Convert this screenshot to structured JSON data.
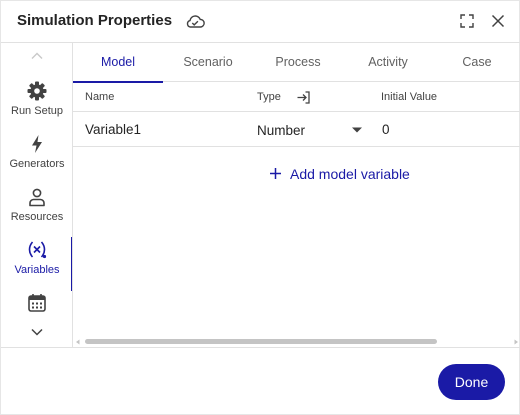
{
  "dialog": {
    "title": "Simulation Properties"
  },
  "colors": {
    "accent": "#1a1aa6",
    "text": "#242424",
    "muted": "#616161",
    "border": "#e1e1e1"
  },
  "icons": {
    "header": [
      "cloud-icon",
      "expand-icon",
      "close-icon"
    ],
    "nav": [
      "gear-icon",
      "lightning-icon",
      "person-icon",
      "variable-icon",
      "calendar-icon"
    ]
  },
  "leftnav": {
    "items": [
      {
        "label": "Run Setup",
        "icon": "gear-icon",
        "active": false
      },
      {
        "label": "Generators",
        "icon": "lightning-icon",
        "active": false
      },
      {
        "label": "Resources",
        "icon": "person-icon",
        "active": false
      },
      {
        "label": "Variables",
        "icon": "variable-icon",
        "active": true
      }
    ]
  },
  "tabs": [
    {
      "label": "Model",
      "active": true
    },
    {
      "label": "Scenario",
      "active": false
    },
    {
      "label": "Process",
      "active": false
    },
    {
      "label": "Activity",
      "active": false
    },
    {
      "label": "Case",
      "active": false
    }
  ],
  "table": {
    "columns": {
      "name": "Name",
      "type": "Type",
      "initial_value": "Initial Value"
    },
    "rows": [
      {
        "name": "Variable1",
        "type": "Number",
        "initial_value": "0"
      }
    ]
  },
  "actions": {
    "add_model_variable": "Add model variable",
    "done": "Done"
  }
}
